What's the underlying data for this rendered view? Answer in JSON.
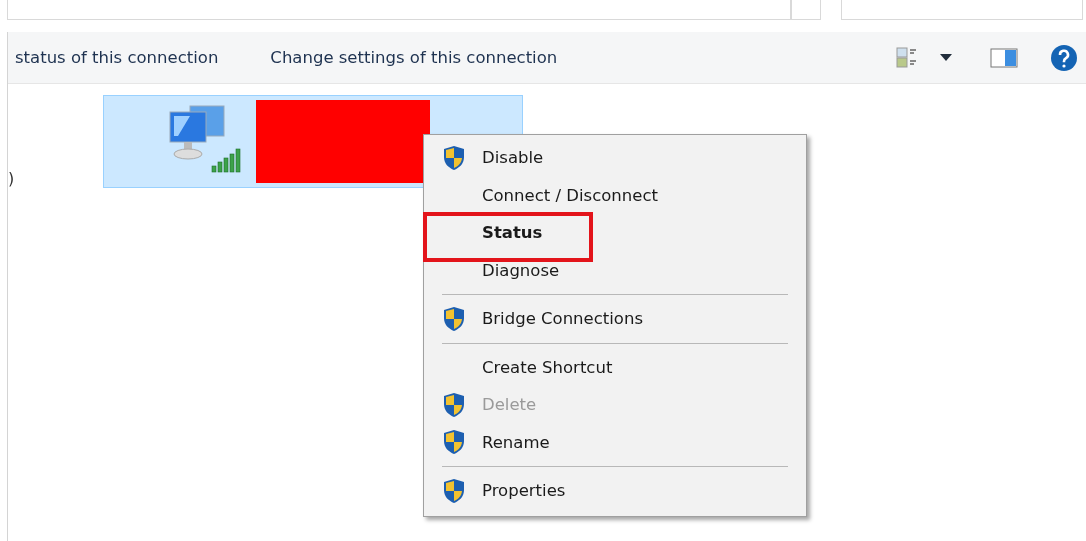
{
  "toolbar": {
    "commands": [
      {
        "label": "status of this connection"
      },
      {
        "label": "Change settings of this connection"
      }
    ]
  },
  "connection": {
    "selected": true,
    "label_redacted": true,
    "detail": ")"
  },
  "context_menu": {
    "items": [
      {
        "kind": "item",
        "label": "Disable",
        "shield": true,
        "disabled": false,
        "default": false,
        "highlighted": false
      },
      {
        "kind": "item",
        "label": "Connect / Disconnect",
        "shield": false,
        "disabled": false,
        "default": false,
        "highlighted": false
      },
      {
        "kind": "item",
        "label": "Status",
        "shield": false,
        "disabled": false,
        "default": true,
        "highlighted": true
      },
      {
        "kind": "item",
        "label": "Diagnose",
        "shield": false,
        "disabled": false,
        "default": false,
        "highlighted": false
      },
      {
        "kind": "separator"
      },
      {
        "kind": "item",
        "label": "Bridge Connections",
        "shield": true,
        "disabled": false,
        "default": false,
        "highlighted": false
      },
      {
        "kind": "separator"
      },
      {
        "kind": "item",
        "label": "Create Shortcut",
        "shield": false,
        "disabled": false,
        "default": false,
        "highlighted": false
      },
      {
        "kind": "item",
        "label": "Delete",
        "shield": true,
        "disabled": true,
        "default": false,
        "highlighted": false
      },
      {
        "kind": "item",
        "label": "Rename",
        "shield": true,
        "disabled": false,
        "default": false,
        "highlighted": false
      },
      {
        "kind": "separator"
      },
      {
        "kind": "item",
        "label": "Properties",
        "shield": true,
        "disabled": false,
        "default": false,
        "highlighted": false
      }
    ]
  }
}
